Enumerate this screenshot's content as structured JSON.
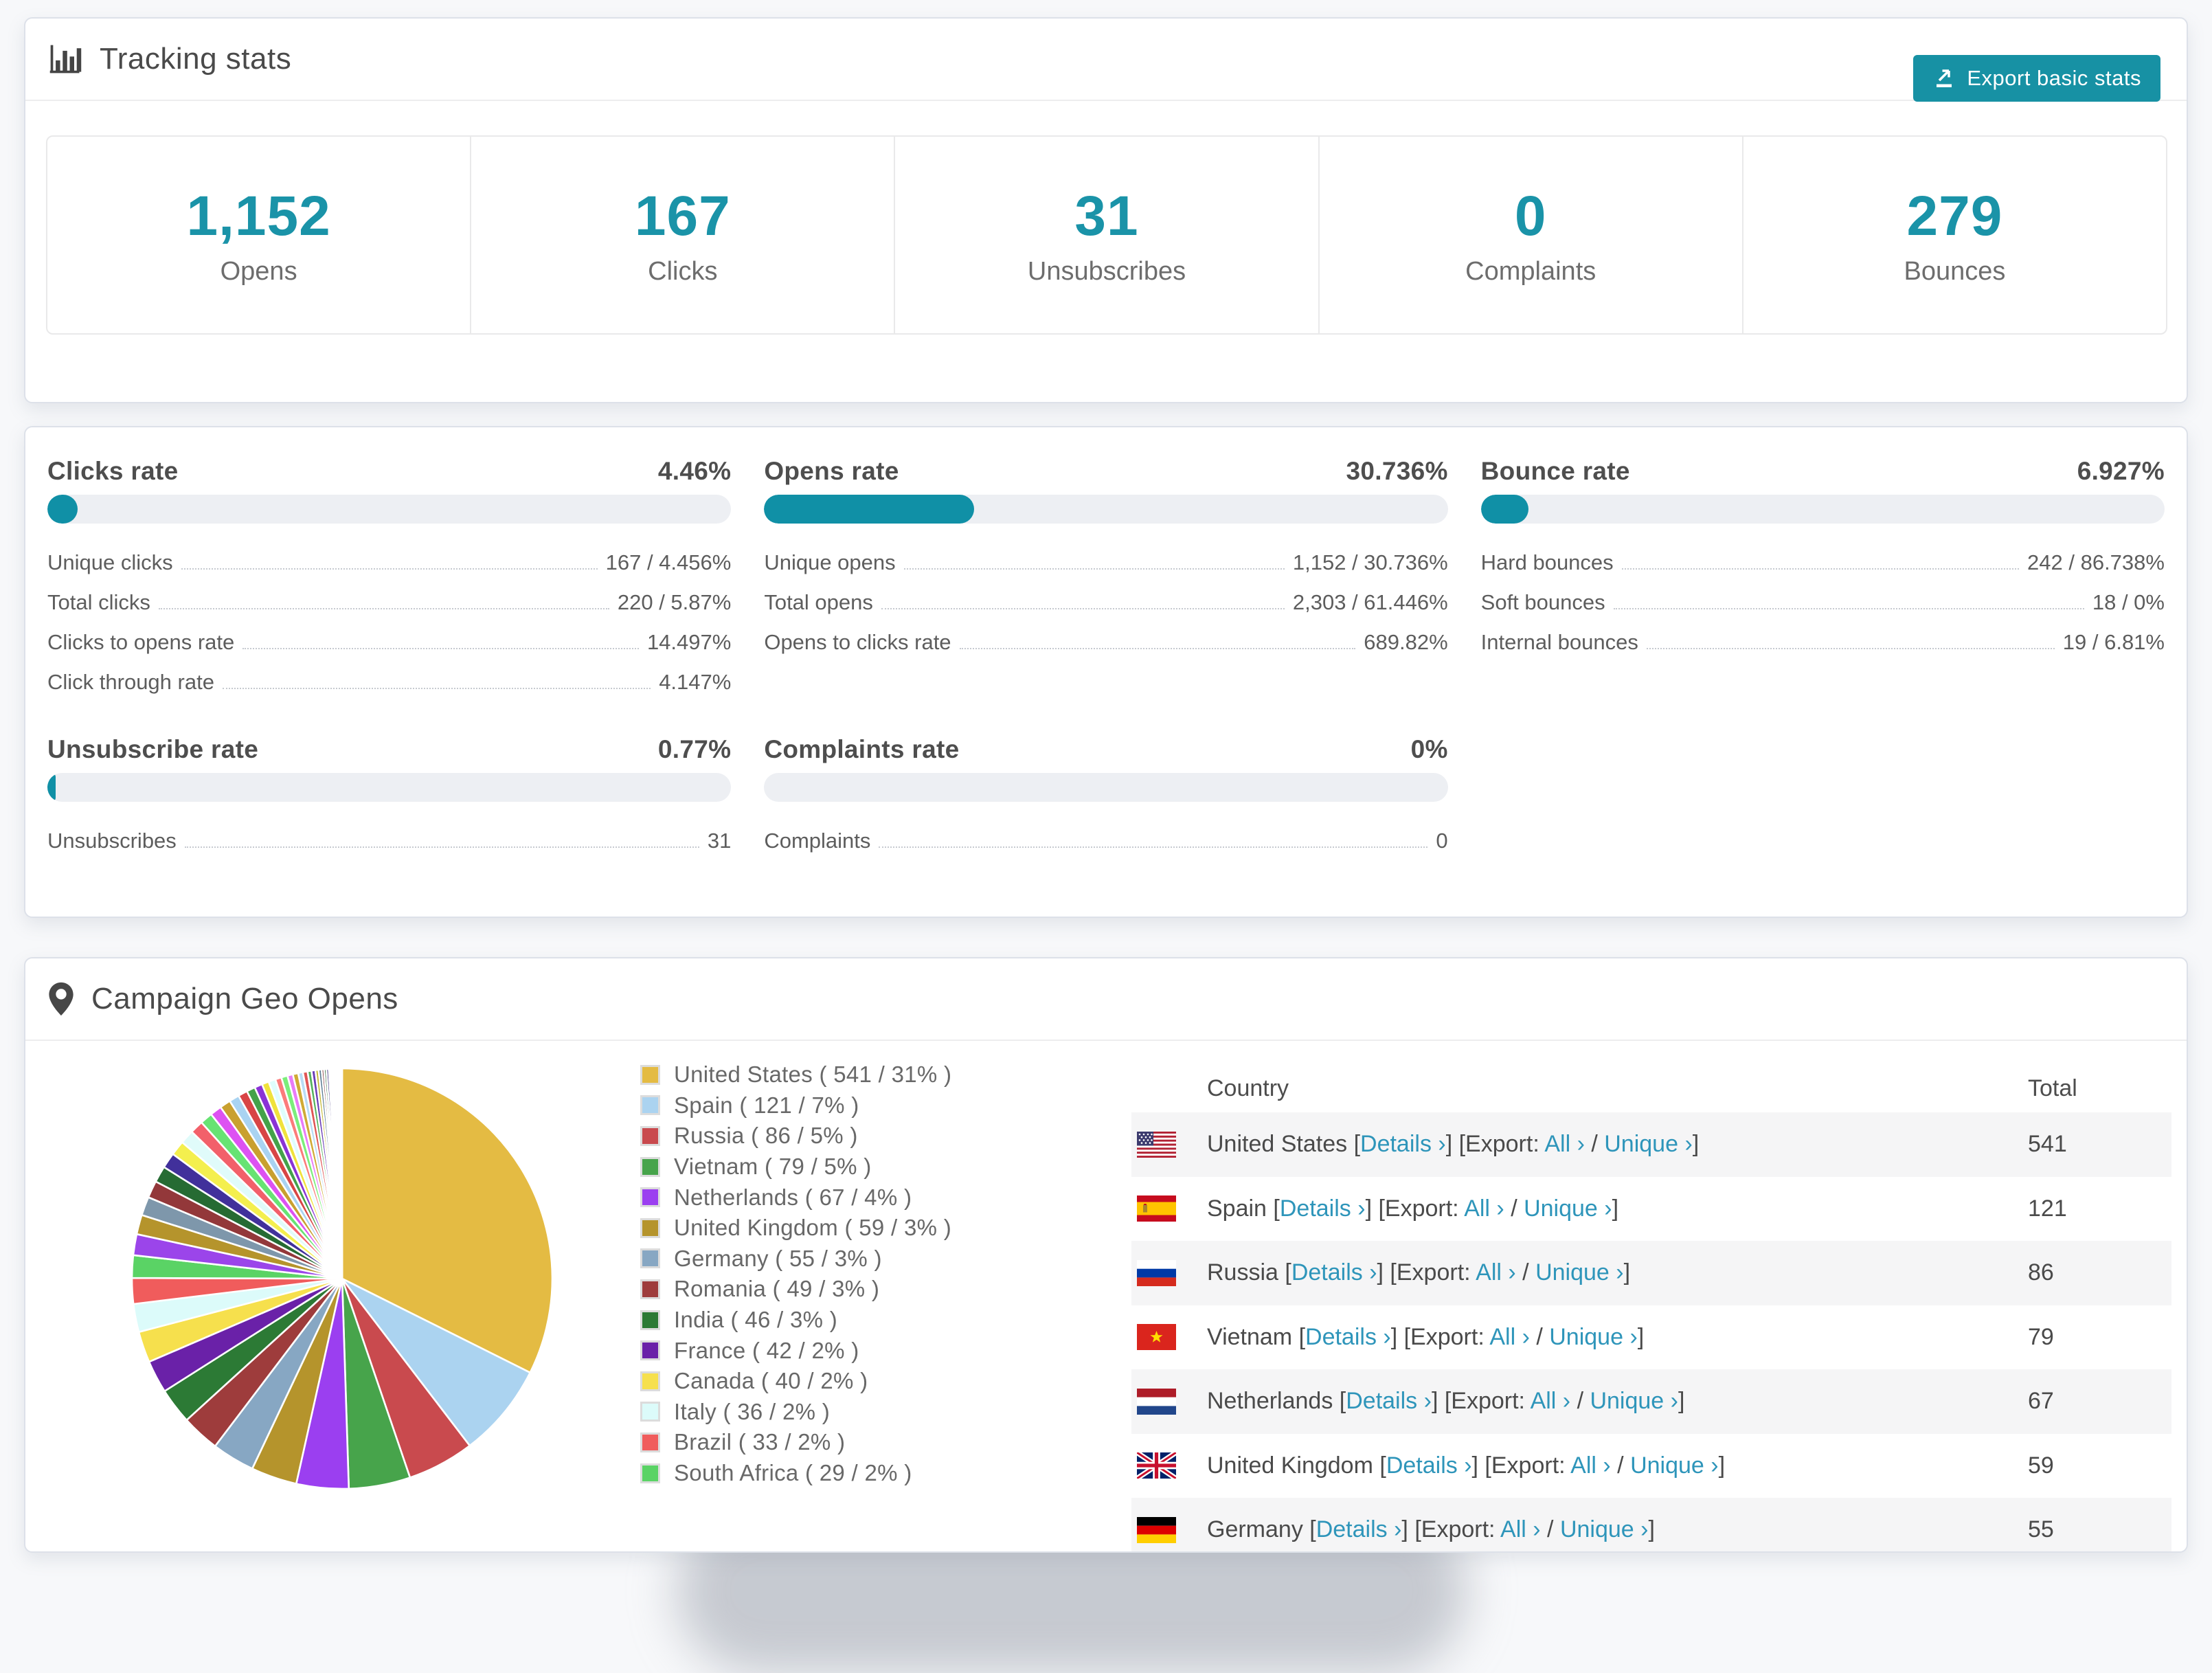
{
  "colors": {
    "accent_teal": "#1791a4",
    "progress_fill": "#1090a6",
    "progress_track": "#edeff3",
    "link": "#2e95ba",
    "stat_number": "#1a93a8",
    "page_background": "#f7f8fa"
  },
  "tracking_card": {
    "title": "Tracking stats",
    "export_button": "Export basic stats",
    "stats": [
      {
        "value": "1,152",
        "label": "Opens"
      },
      {
        "value": "167",
        "label": "Clicks"
      },
      {
        "value": "31",
        "label": "Unsubscribes"
      },
      {
        "value": "0",
        "label": "Complaints"
      },
      {
        "value": "279",
        "label": "Bounces"
      }
    ]
  },
  "rates_card": {
    "sections": [
      {
        "title": "Clicks rate",
        "value": "4.46%",
        "bar_pct": 4.46,
        "rows": [
          {
            "label": "Unique clicks",
            "value": "167 / 4.456%"
          },
          {
            "label": "Total clicks",
            "value": "220 / 5.87%"
          },
          {
            "label": "Clicks to opens rate",
            "value": "14.497%"
          },
          {
            "label": "Click through rate",
            "value": "4.147%"
          }
        ]
      },
      {
        "title": "Opens rate",
        "value": "30.736%",
        "bar_pct": 30.736,
        "rows": [
          {
            "label": "Unique opens",
            "value": "1,152 / 30.736%"
          },
          {
            "label": "Total opens",
            "value": "2,303 / 61.446%"
          },
          {
            "label": "Opens to clicks rate",
            "value": "689.82%"
          }
        ]
      },
      {
        "title": "Bounce rate",
        "value": "6.927%",
        "bar_pct": 6.927,
        "rows": [
          {
            "label": "Hard bounces",
            "value": "242 / 86.738%"
          },
          {
            "label": "Soft bounces",
            "value": "18 / 0%"
          },
          {
            "label": "Internal bounces",
            "value": "19 / 6.81%"
          }
        ]
      },
      {
        "title": "Unsubscribe rate",
        "value": "0.77%",
        "bar_pct": 0.77,
        "rows": [
          {
            "label": "Unsubscribes",
            "value": "31"
          }
        ]
      },
      {
        "title": "Complaints rate",
        "value": "0%",
        "bar_pct": 0,
        "rows": [
          {
            "label": "Complaints",
            "value": "0"
          }
        ]
      }
    ]
  },
  "geo_card": {
    "title": "Campaign Geo Opens",
    "table": {
      "headers": [
        "Country",
        "Total"
      ],
      "link_labels": {
        "details": "Details ›",
        "all": "All ›",
        "unique": "Unique ›",
        "export": "Export:",
        "lb": "[",
        "rb": "]",
        "slash": "/"
      },
      "rows": [
        {
          "country": "United States",
          "flag": "us",
          "total": "541"
        },
        {
          "country": "Spain",
          "flag": "es",
          "total": "121"
        },
        {
          "country": "Russia",
          "flag": "ru",
          "total": "86"
        },
        {
          "country": "Vietnam",
          "flag": "vn",
          "total": "79"
        },
        {
          "country": "Netherlands",
          "flag": "nl",
          "total": "67"
        },
        {
          "country": "United Kingdom",
          "flag": "gb",
          "total": "59"
        },
        {
          "country": "Germany",
          "flag": "de",
          "total": "55"
        }
      ]
    }
  },
  "chart_data": {
    "type": "pie",
    "title": "Campaign Geo Opens",
    "legend_position": "right",
    "start_angle_deg": 0,
    "direction": "clockwise",
    "slices": [
      {
        "name": "United States",
        "count": 541,
        "pct": 31,
        "color": "#e4bb43"
      },
      {
        "name": "Spain",
        "count": 121,
        "pct": 7,
        "color": "#abd3f0"
      },
      {
        "name": "Russia",
        "count": 86,
        "pct": 5,
        "color": "#c94a4e"
      },
      {
        "name": "Vietnam",
        "count": 79,
        "pct": 5,
        "color": "#47a44b"
      },
      {
        "name": "Netherlands",
        "count": 67,
        "pct": 4,
        "color": "#9b3ff0"
      },
      {
        "name": "United Kingdom",
        "count": 59,
        "pct": 3,
        "color": "#b5942c"
      },
      {
        "name": "Germany",
        "count": 55,
        "pct": 3,
        "color": "#87a7c3"
      },
      {
        "name": "Romania",
        "count": 49,
        "pct": 3,
        "color": "#9e3c3c"
      },
      {
        "name": "India",
        "count": 46,
        "pct": 3,
        "color": "#2c7a35"
      },
      {
        "name": "France",
        "count": 42,
        "pct": 2,
        "color": "#6a21a8"
      },
      {
        "name": "Canada",
        "count": 40,
        "pct": 2,
        "color": "#f6e04d"
      },
      {
        "name": "Italy",
        "count": 36,
        "pct": 2,
        "color": "#dcfbfa"
      },
      {
        "name": "Brazil",
        "count": 33,
        "pct": 2,
        "color": "#f05c5c"
      },
      {
        "name": "South Africa",
        "count": 29,
        "pct": 2,
        "color": "#5ad365"
      }
    ],
    "others": [
      {
        "value": 27,
        "color": "#9b45ea"
      },
      {
        "value": 25,
        "color": "#b5942c"
      },
      {
        "value": 24,
        "color": "#7e97ab"
      },
      {
        "value": 22,
        "color": "#93383a"
      },
      {
        "value": 21,
        "color": "#266b33"
      },
      {
        "value": 20,
        "color": "#41309b"
      },
      {
        "value": 19,
        "color": "#f4ef4e"
      },
      {
        "value": 18,
        "color": "#e0fbfa"
      },
      {
        "value": 17,
        "color": "#f2606a"
      },
      {
        "value": 16,
        "color": "#67e373"
      },
      {
        "value": 15,
        "color": "#dd52f2"
      },
      {
        "value": 14,
        "color": "#c9a02f"
      },
      {
        "value": 13,
        "color": "#a9d3f1"
      },
      {
        "value": 12,
        "color": "#d84545"
      },
      {
        "value": 11,
        "color": "#44a24a"
      },
      {
        "value": 10,
        "color": "#8a33d6"
      },
      {
        "value": 9,
        "color": "#f0e23c"
      },
      {
        "value": 9,
        "color": "#dffdfd"
      },
      {
        "value": 8,
        "color": "#fb7b7b"
      },
      {
        "value": 8,
        "color": "#7bee7b"
      },
      {
        "value": 7,
        "color": "#e87bf9"
      },
      {
        "value": 7,
        "color": "#d0aa35"
      },
      {
        "value": 6,
        "color": "#b8dcf5"
      },
      {
        "value": 6,
        "color": "#e05555"
      },
      {
        "value": 5,
        "color": "#55b25c"
      },
      {
        "value": 5,
        "color": "#6a3db8"
      },
      {
        "value": 4,
        "color": "#c4b72e"
      },
      {
        "value": 4,
        "color": "#5d7d93"
      },
      {
        "value": 3,
        "color": "#7a2e30"
      },
      {
        "value": 3,
        "color": "#1d5a2a"
      },
      {
        "value": 3,
        "color": "#322578"
      },
      {
        "value": 2,
        "color": "#eae649"
      },
      {
        "value": 2,
        "color": "#ccf7f5"
      },
      {
        "value": 2,
        "color": "#ef8b8b"
      },
      {
        "value": 2,
        "color": "#8df28d"
      },
      {
        "value": 1,
        "color": "#e99ef7"
      },
      {
        "value": 1,
        "color": "#d9b93c"
      },
      {
        "value": 1,
        "color": "#9fc8e8"
      },
      {
        "value": 1,
        "color": "#c64848"
      },
      {
        "value": 1,
        "color": "#3f9e47"
      },
      {
        "value": 1,
        "color": "#7e3fd0"
      },
      {
        "value": 1,
        "color": "#ece63f"
      },
      {
        "value": 1,
        "color": "#b7efec"
      },
      {
        "value": 1,
        "color": "#f79a9a"
      }
    ]
  }
}
